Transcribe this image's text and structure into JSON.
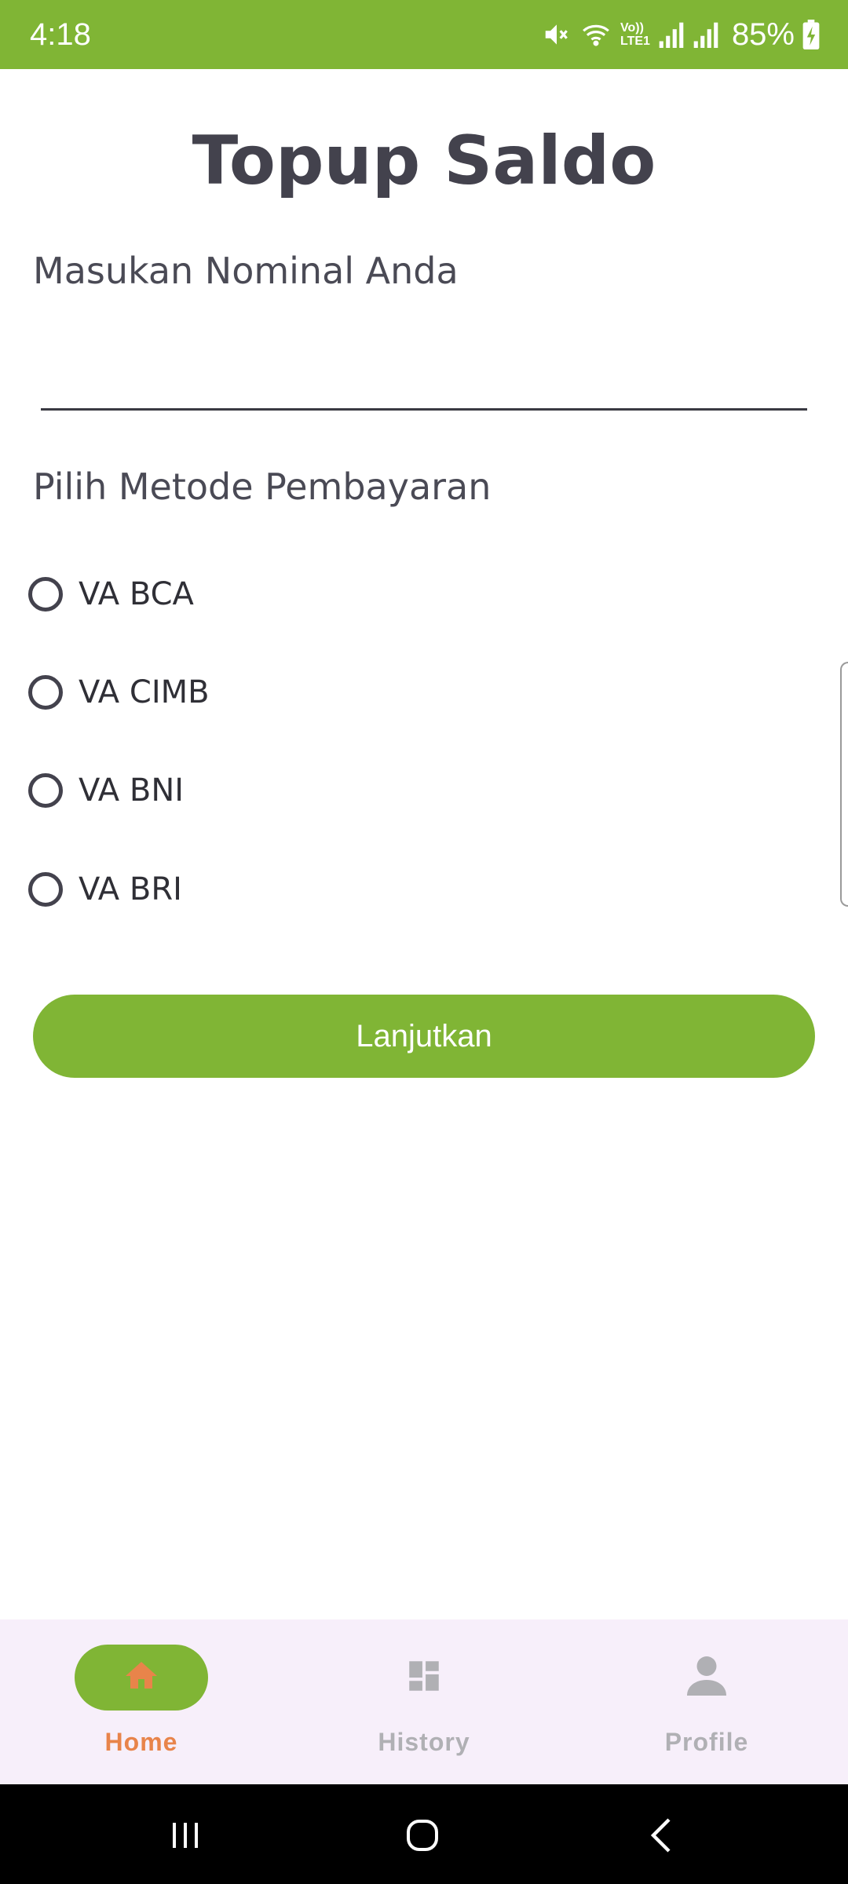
{
  "status_bar": {
    "time": "4:18",
    "battery": "85%",
    "background_color": "#80b535",
    "icons": [
      "mute-icon",
      "wifi-icon",
      "volte-icon",
      "signal-icon",
      "signal-icon",
      "battery-charging-icon"
    ],
    "volte_text": [
      "Vo))",
      "LTE1"
    ]
  },
  "page": {
    "title": "Topup Saldo",
    "amount_label": "Masukan Nominal Anda",
    "amount_value": "",
    "method_label": "Pilih Metode Pembayaran"
  },
  "payment_methods": [
    {
      "label": "VA BCA",
      "selected": false
    },
    {
      "label": "VA CIMB",
      "selected": false
    },
    {
      "label": "VA BNI",
      "selected": false
    },
    {
      "label": "VA BRI",
      "selected": false
    }
  ],
  "actions": {
    "continue_label": "Lanjutkan",
    "accent_color": "#80b535"
  },
  "bottom_nav": {
    "items": [
      {
        "label": "Home",
        "icon": "home-icon",
        "active": true,
        "color": "#e8844a"
      },
      {
        "label": "History",
        "icon": "dashboard-icon",
        "active": false,
        "color": "#b0b0b4"
      },
      {
        "label": "Profile",
        "icon": "person-icon",
        "active": false,
        "color": "#b0b0b4"
      }
    ]
  },
  "system_nav": {
    "icons": [
      "recents-icon",
      "home-circle-icon",
      "back-icon"
    ]
  }
}
